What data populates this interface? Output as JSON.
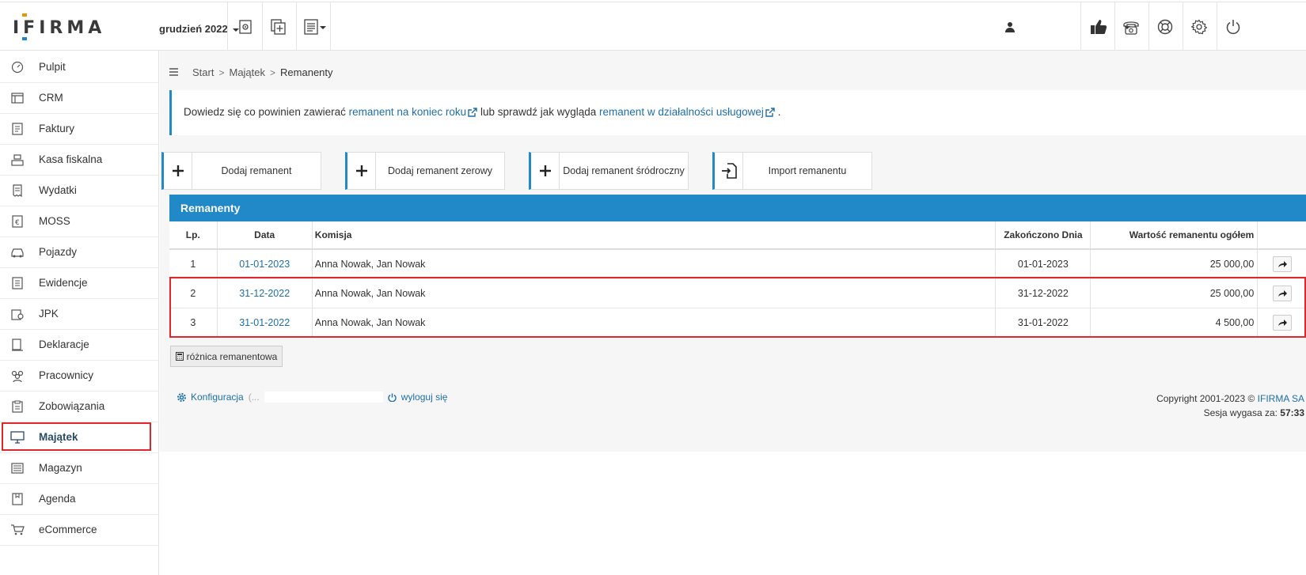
{
  "app": {
    "logo_text": "IFIRMA",
    "period": "grudzień 2022"
  },
  "topbar": {
    "icons": [
      "document-settings-icon",
      "add-document-icon",
      "report-icon",
      "user-icon",
      "thumbs-up-icon",
      "phone-icon",
      "lifebuoy-icon",
      "gear-icon",
      "power-icon"
    ]
  },
  "sidebar": {
    "items": [
      {
        "label": "Pulpit",
        "icon": "dashboard-icon"
      },
      {
        "label": "CRM",
        "icon": "crm-icon"
      },
      {
        "label": "Faktury",
        "icon": "invoice-icon"
      },
      {
        "label": "Kasa fiskalna",
        "icon": "cash-register-icon"
      },
      {
        "label": "Wydatki",
        "icon": "receipt-icon"
      },
      {
        "label": "MOSS",
        "icon": "moss-icon"
      },
      {
        "label": "Pojazdy",
        "icon": "car-icon"
      },
      {
        "label": "Ewidencje",
        "icon": "ledger-icon"
      },
      {
        "label": "JPK",
        "icon": "jpk-icon"
      },
      {
        "label": "Deklaracje",
        "icon": "declaration-icon"
      },
      {
        "label": "Pracownicy",
        "icon": "employees-icon"
      },
      {
        "label": "Zobowiązania",
        "icon": "obligations-icon"
      },
      {
        "label": "Majątek",
        "icon": "monitor-icon"
      },
      {
        "label": "Magazyn",
        "icon": "warehouse-icon"
      },
      {
        "label": "Agenda",
        "icon": "agenda-icon"
      },
      {
        "label": "eCommerce",
        "icon": "cart-icon"
      }
    ]
  },
  "breadcrumb": {
    "start": "Start",
    "level1": "Majątek",
    "current": "Remanenty"
  },
  "info": {
    "text1": "Dowiedz się co powinien zawierać ",
    "link1": "remanent na koniec roku",
    "text2": " lub sprawdź jak wygląda ",
    "link2": "remanent w działalności usługowej",
    "text3": " ."
  },
  "actions": {
    "add": "Dodaj remanent",
    "add_zero": "Dodaj remanent zerowy",
    "add_mid": "Dodaj remanent śródroczny",
    "import": "Import remanentu"
  },
  "table": {
    "title": "Remanenty",
    "headers": {
      "lp": "Lp.",
      "data": "Data",
      "komisja": "Komisja",
      "zakonczono": "Zakończono Dnia",
      "wartosc": "Wartość remanentu ogółem"
    },
    "rows": [
      {
        "lp": "1",
        "data": "01-01-2023",
        "komisja": "Anna Nowak, Jan Nowak",
        "zakonczono": "01-01-2023",
        "wartosc": "25 000,00"
      },
      {
        "lp": "2",
        "data": "31-12-2022",
        "komisja": "Anna Nowak, Jan Nowak",
        "zakonczono": "31-12-2022",
        "wartosc": "25 000,00"
      },
      {
        "lp": "3",
        "data": "31-01-2022",
        "komisja": "Anna Nowak, Jan Nowak",
        "zakonczono": "31-01-2022",
        "wartosc": "4 500,00"
      }
    ]
  },
  "diff_button": "różnica remanentowa",
  "footer": {
    "config": "Konfiguracja",
    "config_suffix": "(...",
    "logout": "wyloguj się",
    "copyright": "Copyright 2001-2023 © ",
    "company": "IFIRMA SA",
    "session_label": "Sesja wygasa za: ",
    "session_time": "57:33"
  },
  "colors": {
    "accent": "#2189c7",
    "highlight": "#e0272b",
    "link": "#1e6fa8"
  }
}
